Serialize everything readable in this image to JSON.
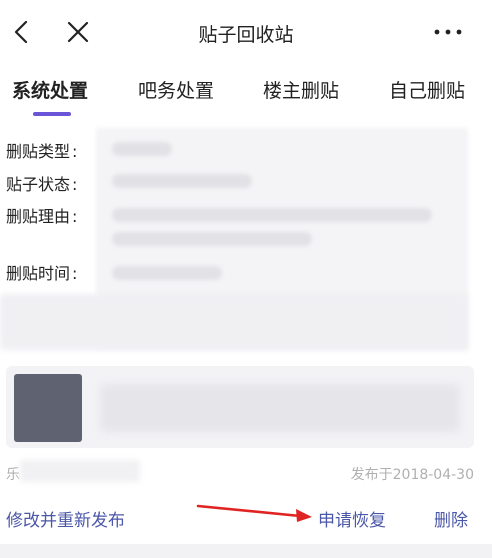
{
  "header": {
    "title": "贴子回收站",
    "back_icon": "chevron-left-icon",
    "close_icon": "close-icon",
    "more_icon": "more-horizontal-icon"
  },
  "tabs": [
    {
      "label": "系统处置",
      "active": true
    },
    {
      "label": "吧务处置",
      "active": false
    },
    {
      "label": "楼主删贴",
      "active": false
    },
    {
      "label": "自己删贴",
      "active": false
    }
  ],
  "accent_color": "#6a55d8",
  "post": {
    "fields": [
      {
        "label": "删贴类型",
        "colon": ":"
      },
      {
        "label": "贴子状态",
        "colon": ":"
      },
      {
        "label": "删贴理由",
        "colon": ":"
      },
      {
        "label": "删贴时间",
        "colon": ":"
      }
    ],
    "author_initial": "乐",
    "published": "发布于2018-04-30"
  },
  "actions": {
    "edit_republish": "修改并重新发布",
    "request_restore": "申请恢复",
    "delete": "删除",
    "link_color": "#4b57a8",
    "annotation_arrow_color": "#e02424"
  }
}
